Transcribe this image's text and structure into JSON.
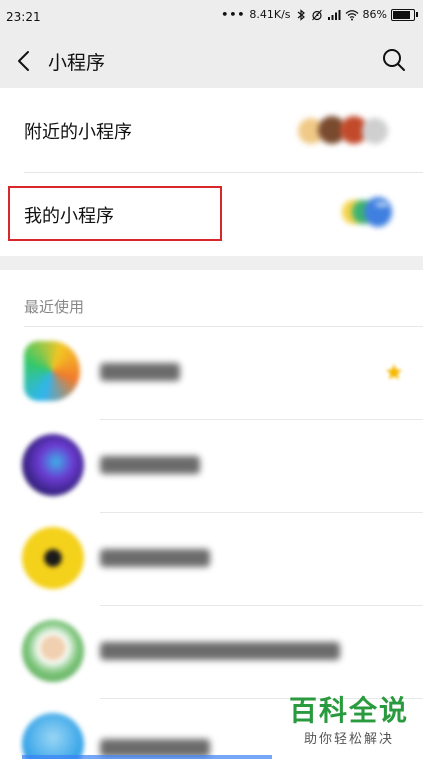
{
  "status_bar": {
    "time": "23:21",
    "network_speed": "8.41K/s",
    "battery_percent": "86%",
    "icons": [
      "more-dots-icon",
      "bluetooth-icon",
      "alarm-icon",
      "signal-icon",
      "wifi-icon",
      "battery-icon"
    ]
  },
  "nav": {
    "title": "小程序",
    "back_icon": "back-arrow-icon",
    "search_icon": "search-icon"
  },
  "items": {
    "nearby": "附近的小程序",
    "mine": "我的小程序"
  },
  "recent": {
    "section_title": "最近使用",
    "apps": [
      {
        "icon": "app-icon-video",
        "starred": true
      },
      {
        "icon": "app-icon-purple",
        "starred": false
      },
      {
        "icon": "app-icon-yellow",
        "starred": false
      },
      {
        "icon": "app-icon-green",
        "starred": false
      },
      {
        "icon": "app-icon-blue",
        "starred": false
      }
    ]
  },
  "watermark": {
    "title": "百科全说",
    "subtitle": "助你轻松解决"
  },
  "colors": {
    "highlight_border": "#d9262b",
    "watermark_green": "#2a9a3f",
    "header_bg": "#ededed"
  }
}
